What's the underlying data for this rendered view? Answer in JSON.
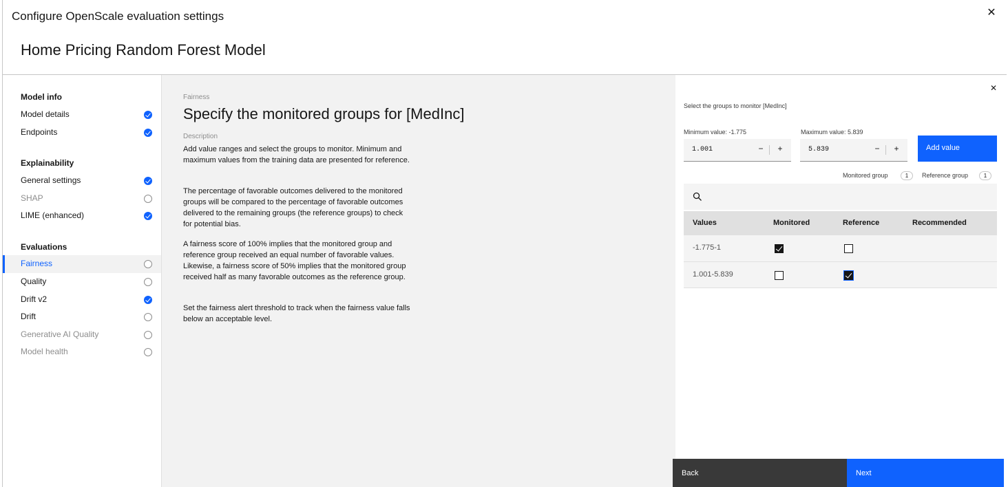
{
  "modal": {
    "title": "Configure OpenScale evaluation settings",
    "model_name": "Home Pricing Random Forest Model",
    "close_icon": "close-icon"
  },
  "sidebar": {
    "sections": [
      {
        "heading": "Model info",
        "items": [
          {
            "label": "Model details",
            "status": "done"
          },
          {
            "label": "Endpoints",
            "status": "done"
          }
        ]
      },
      {
        "heading": "Explainability",
        "items": [
          {
            "label": "General settings",
            "status": "done"
          },
          {
            "label": "SHAP",
            "status": "todo",
            "disabled": true
          },
          {
            "label": "LIME (enhanced)",
            "status": "done"
          }
        ]
      },
      {
        "heading": "Evaluations",
        "items": [
          {
            "label": "Fairness",
            "status": "todo",
            "active": true
          },
          {
            "label": "Quality",
            "status": "todo"
          },
          {
            "label": "Drift v2",
            "status": "done"
          },
          {
            "label": "Drift",
            "status": "todo"
          },
          {
            "label": "Generative AI Quality",
            "status": "todo",
            "disabled": true
          },
          {
            "label": "Model health",
            "status": "todo",
            "disabled": true
          }
        ]
      }
    ]
  },
  "main": {
    "eyebrow": "Fairness",
    "title": "Specify the monitored groups for [MedInc]",
    "description_label": "Description",
    "paragraphs": [
      "Add value ranges and select the groups to monitor. Minimum and maximum values from the training data are presented for reference.",
      "The percentage of favorable outcomes delivered to the monitored groups will be compared to the percentage of favorable outcomes delivered to the remaining groups (the reference groups) to check for potential bias.",
      "A fairness score of 100% implies that the monitored group and reference group received an equal number of favorable values. Likewise, a fairness score of 50% implies that the monitored group received half as many favorable outcomes as the reference group.",
      "Set the fairness alert threshold to track when the fairness value falls below an acceptable level."
    ]
  },
  "panel": {
    "caption": "Select the groups to monitor [MedInc]",
    "min_label": "Minimum value: -1.775",
    "max_label": "Maximum value: 5.839",
    "min_value": "1.001",
    "max_value": "5.839",
    "minus": "−",
    "plus": "+",
    "add_button": "Add value",
    "monitored_group_label": "Monitored group",
    "monitored_group_count": "1",
    "reference_group_label": "Reference group",
    "reference_group_count": "1",
    "table": {
      "headers": [
        "Values",
        "Monitored",
        "Reference",
        "Recommended"
      ],
      "rows": [
        {
          "value": "-1.775-1",
          "monitored": true,
          "reference": false,
          "recommended": ""
        },
        {
          "value": "1.001-5.839",
          "monitored": false,
          "reference": true,
          "recommended": ""
        }
      ]
    }
  },
  "footer": {
    "back": "Back",
    "next": "Next"
  },
  "colors": {
    "accent": "#0f62fe",
    "content_bg": "#f2f2f2",
    "footer_back_bg": "#393939"
  }
}
